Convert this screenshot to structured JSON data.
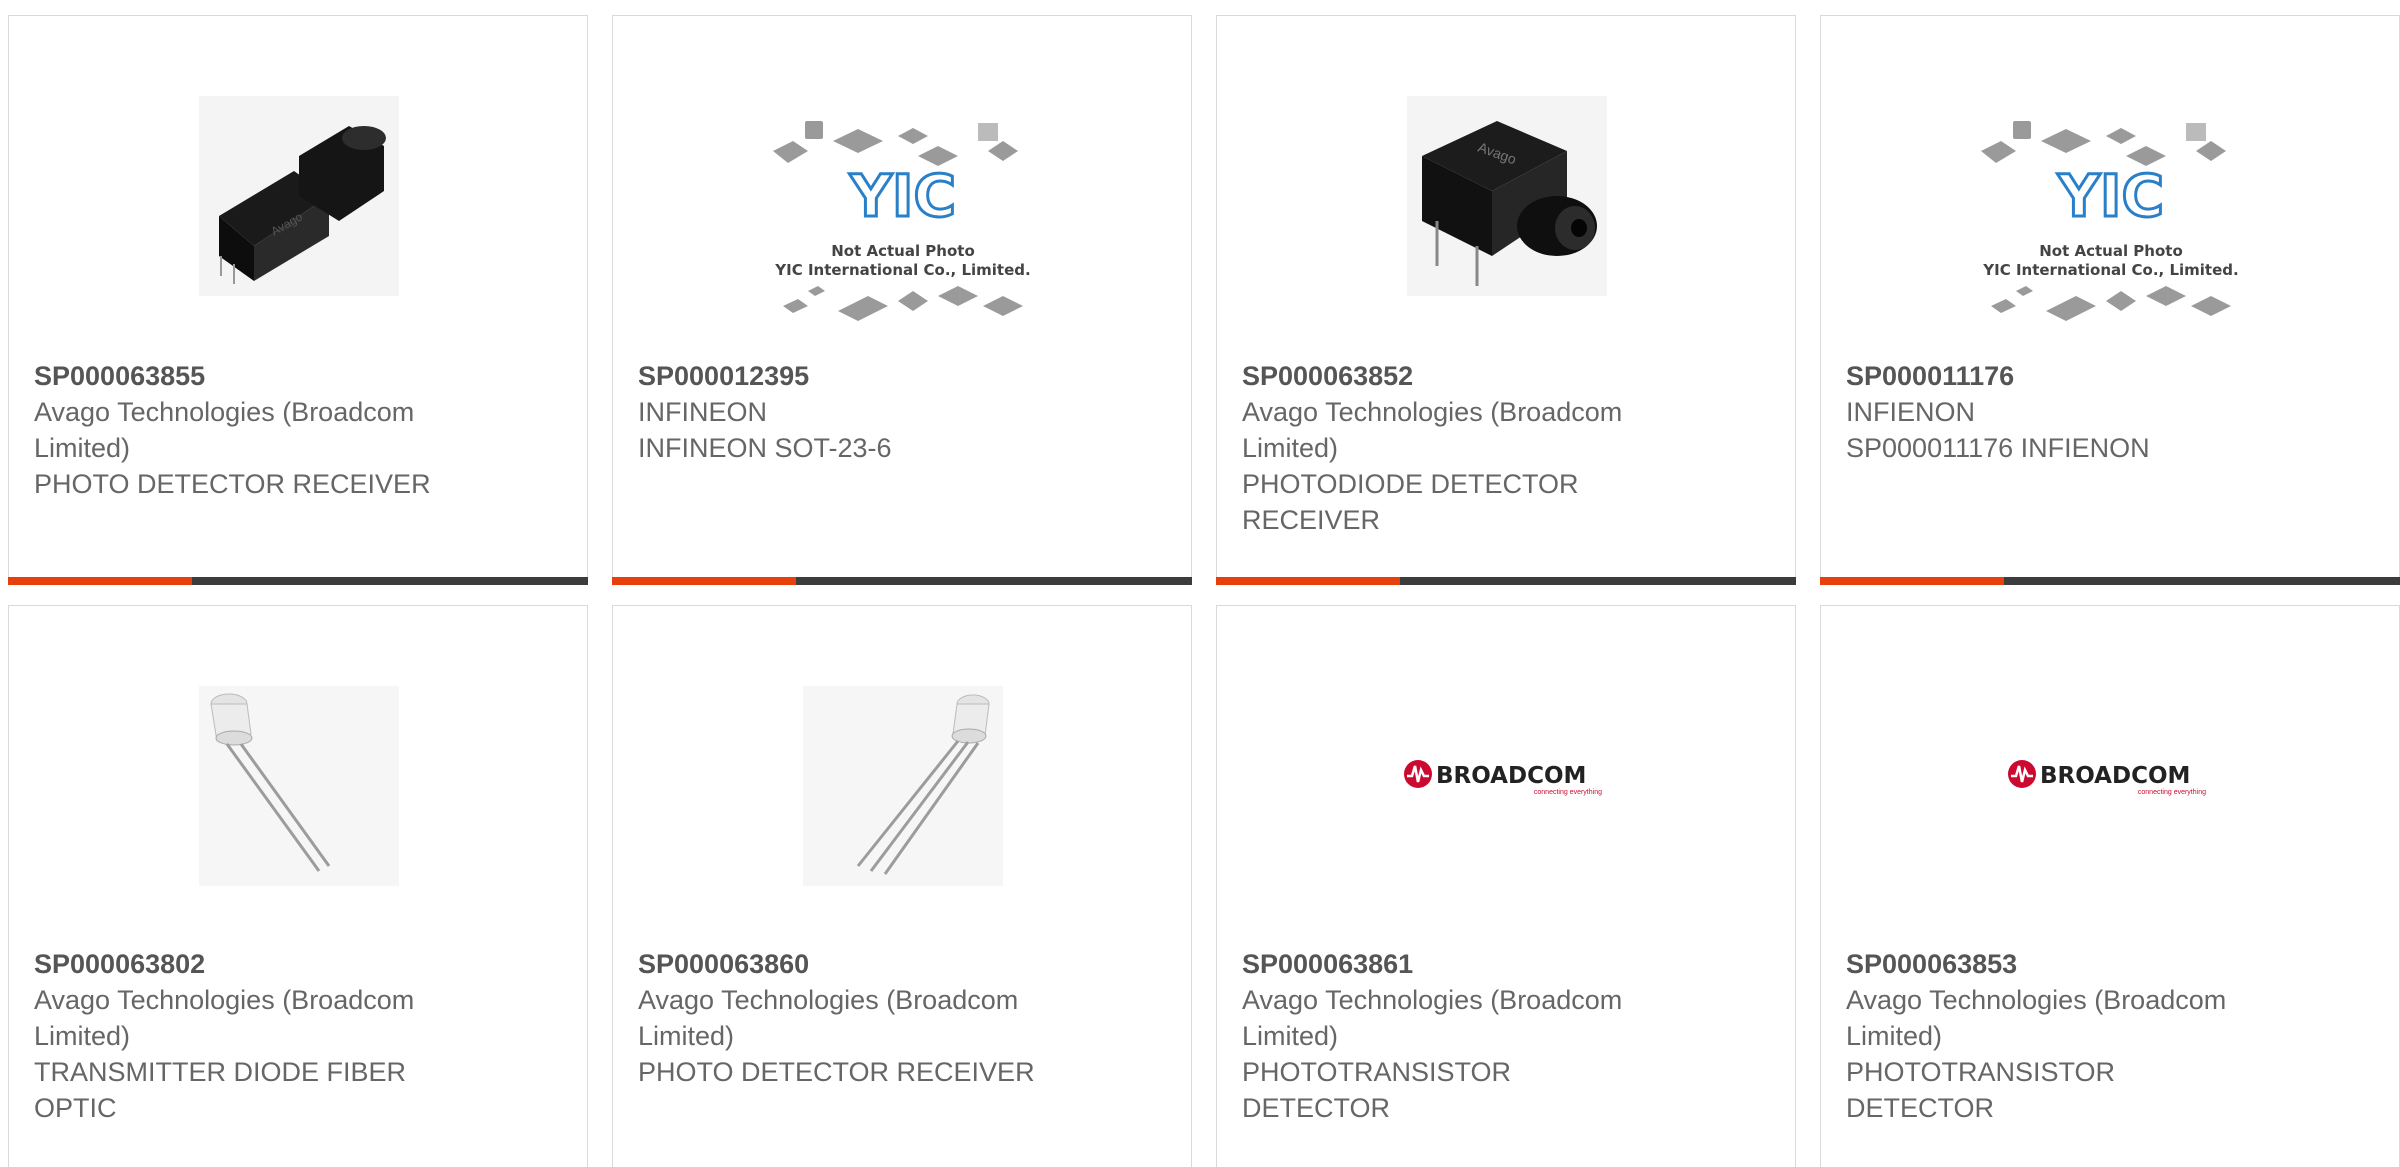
{
  "products": [
    {
      "part": "SP000063855",
      "maker": "Avago Technologies (Broadcom",
      "maker2": "Limited)",
      "desc": "PHOTO DETECTOR RECEIVER",
      "desc2": "",
      "image": "black-receiver-photo"
    },
    {
      "part": "SP000012395",
      "maker": "INFINEON",
      "maker2": "",
      "desc": "INFINEON SOT-23-6",
      "desc2": "",
      "image": "yic-placeholder"
    },
    {
      "part": "SP000063852",
      "maker": "Avago Technologies (Broadcom",
      "maker2": "Limited)",
      "desc": "PHOTODIODE DETECTOR",
      "desc2": "RECEIVER",
      "image": "black-detector-photo"
    },
    {
      "part": "SP000011176",
      "maker": "INFIENON",
      "maker2": "",
      "desc": "SP000011176 INFIENON",
      "desc2": "",
      "image": "yic-placeholder"
    },
    {
      "part": "SP000063802",
      "maker": "Avago Technologies (Broadcom",
      "maker2": "Limited)",
      "desc": "TRANSMITTER DIODE FIBER",
      "desc2": "OPTIC",
      "image": "clear-led-photo"
    },
    {
      "part": "SP000063860",
      "maker": "Avago Technologies (Broadcom",
      "maker2": "Limited)",
      "desc": "PHOTO DETECTOR RECEIVER",
      "desc2": "",
      "image": "clear-led-photo"
    },
    {
      "part": "SP000063861",
      "maker": "Avago Technologies (Broadcom",
      "maker2": "Limited)",
      "desc": "PHOTOTRANSISTOR",
      "desc2": "DETECTOR",
      "image": "broadcom-logo"
    },
    {
      "part": "SP000063853",
      "maker": "Avago Technologies (Broadcom",
      "maker2": "Limited)",
      "desc": "PHOTOTRANSISTOR",
      "desc2": "DETECTOR",
      "image": "broadcom-logo"
    }
  ],
  "placeholder": {
    "line1": "Not Actual Photo",
    "line2": "YIC International Co., Limited.",
    "logo": "YIC"
  },
  "broadcom": {
    "name": "BROADCOM",
    "tagline": "connecting everything"
  },
  "colors": {
    "accent": "#e8400c",
    "bar": "#3c3c3c",
    "text": "#666666",
    "border": "#d9d9d9",
    "broadcom_red": "#cc092f"
  }
}
